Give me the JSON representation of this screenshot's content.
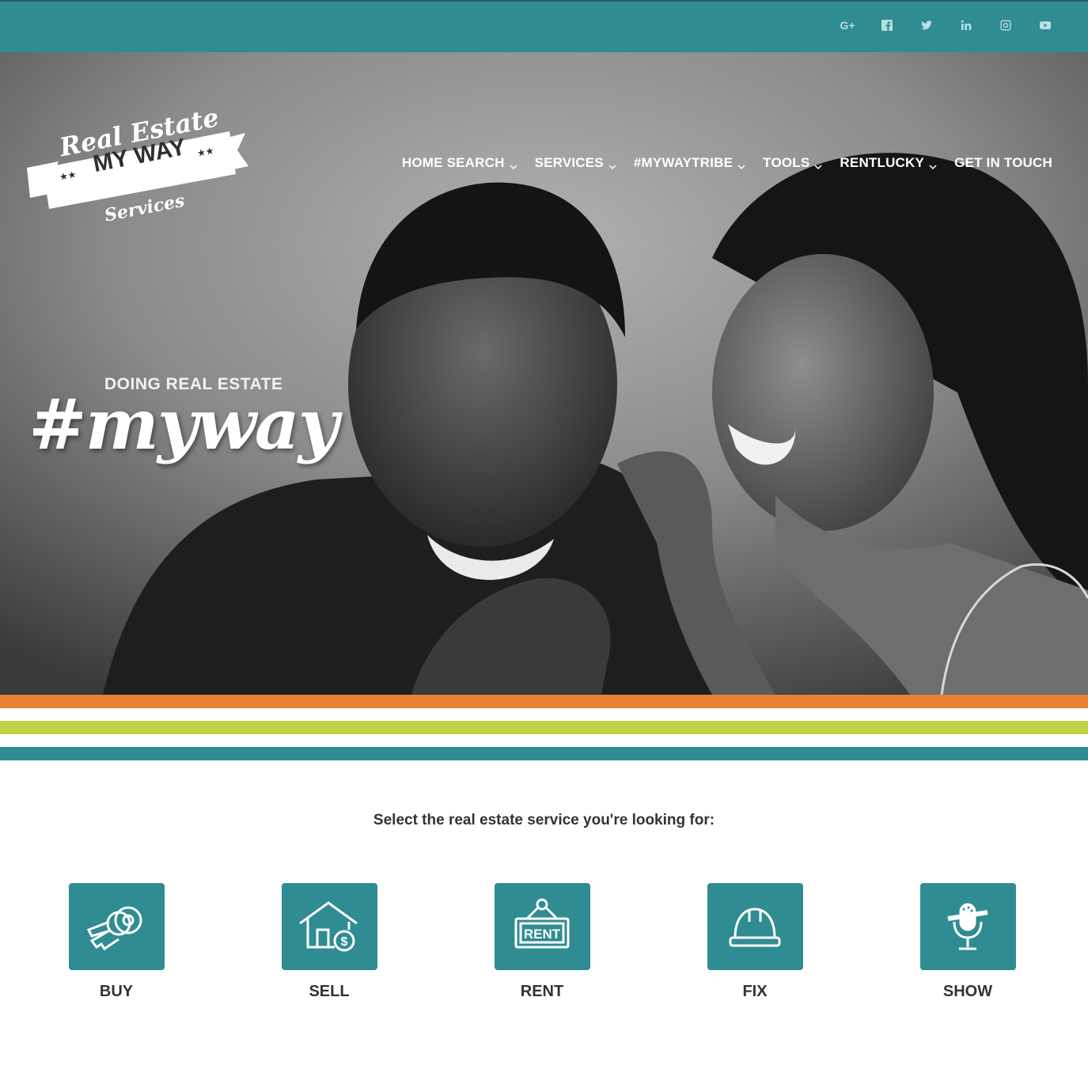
{
  "social": {
    "icons": [
      "google-plus-icon",
      "facebook-icon",
      "twitter-icon",
      "linkedin-icon",
      "instagram-icon",
      "youtube-icon"
    ],
    "gplus_text": "G+"
  },
  "logo": {
    "line1": "Real Estate",
    "line2": "MY WAY",
    "line3": "Services"
  },
  "nav": {
    "items": [
      {
        "label": "HOME SEARCH",
        "dropdown": true
      },
      {
        "label": "SERVICES",
        "dropdown": true
      },
      {
        "label": "#MYWAYTRIBE",
        "dropdown": true
      },
      {
        "label": "TOOLS",
        "dropdown": true
      },
      {
        "label": "RENTLUCKY",
        "dropdown": true
      },
      {
        "label": "GET IN TOUCH",
        "dropdown": false
      }
    ]
  },
  "hero": {
    "tagline_small": "DOING REAL ESTATE",
    "tagline_big": "#myway"
  },
  "colors": {
    "teal": "#2f8c92",
    "orange": "#e98234",
    "green": "#bfd147"
  },
  "services": {
    "prompt": "Select the real estate service you're looking for:",
    "items": [
      {
        "label": "BUY",
        "icon": "keys-icon"
      },
      {
        "label": "SELL",
        "icon": "house-money-icon"
      },
      {
        "label": "RENT",
        "icon": "rent-sign-icon",
        "sign_text": "RENT"
      },
      {
        "label": "FIX",
        "icon": "hard-hat-icon"
      },
      {
        "label": "SHOW",
        "icon": "microphone-icon"
      }
    ]
  }
}
